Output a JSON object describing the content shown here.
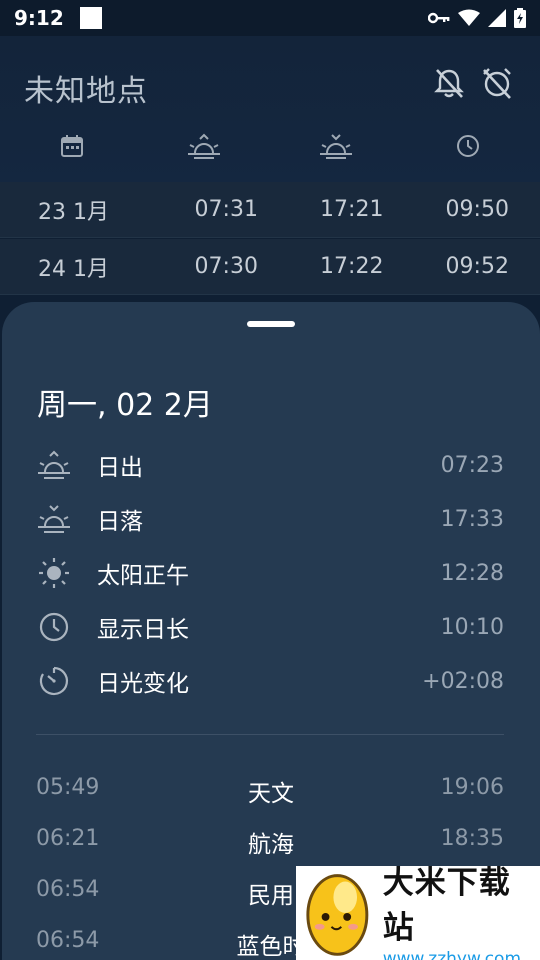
{
  "status_bar": {
    "time": "9:12",
    "icons": [
      "vpn-key-icon",
      "wifi-icon",
      "signal-icon",
      "battery-icon"
    ]
  },
  "header": {
    "title": "未知地点",
    "actions": [
      "bell-off-icon",
      "alarm-off-icon"
    ],
    "columns": [
      "calendar-icon",
      "sunrise-icon",
      "sunset-icon",
      "clock-icon"
    ]
  },
  "table": {
    "rows": [
      {
        "date": "23 1月",
        "sunrise": "07:31",
        "sunset": "17:21",
        "length": "09:50"
      },
      {
        "date": "24 1月",
        "sunrise": "07:30",
        "sunset": "17:22",
        "length": "09:52"
      }
    ]
  },
  "sheet": {
    "date": "周一, 02 2月",
    "items": [
      {
        "icon": "sunrise-icon",
        "label": "日出",
        "value": "07:23"
      },
      {
        "icon": "sunset-icon",
        "label": "日落",
        "value": "17:33"
      },
      {
        "icon": "sun-icon",
        "label": "太阳正午",
        "value": "12:28"
      },
      {
        "icon": "clock-icon",
        "label": "显示日长",
        "value": "10:10"
      },
      {
        "icon": "timer-icon",
        "label": "日光变化",
        "value": "+02:08"
      }
    ],
    "twilight": [
      {
        "start": "05:49",
        "name": "天文",
        "end": "19:06"
      },
      {
        "start": "06:21",
        "name": "航海",
        "end": "18:35"
      },
      {
        "start": "06:54",
        "name": "民用",
        "end": ""
      },
      {
        "start": "06:54",
        "name": "蓝色时",
        "end": ""
      }
    ]
  },
  "watermark": {
    "title": "大米下载站",
    "url": "www.zzhyw.com"
  },
  "colors": {
    "header_bg": "#13243a",
    "row_bg": "#19293c",
    "sheet_bg": "#253a51",
    "accent_url": "#1a9be6"
  }
}
